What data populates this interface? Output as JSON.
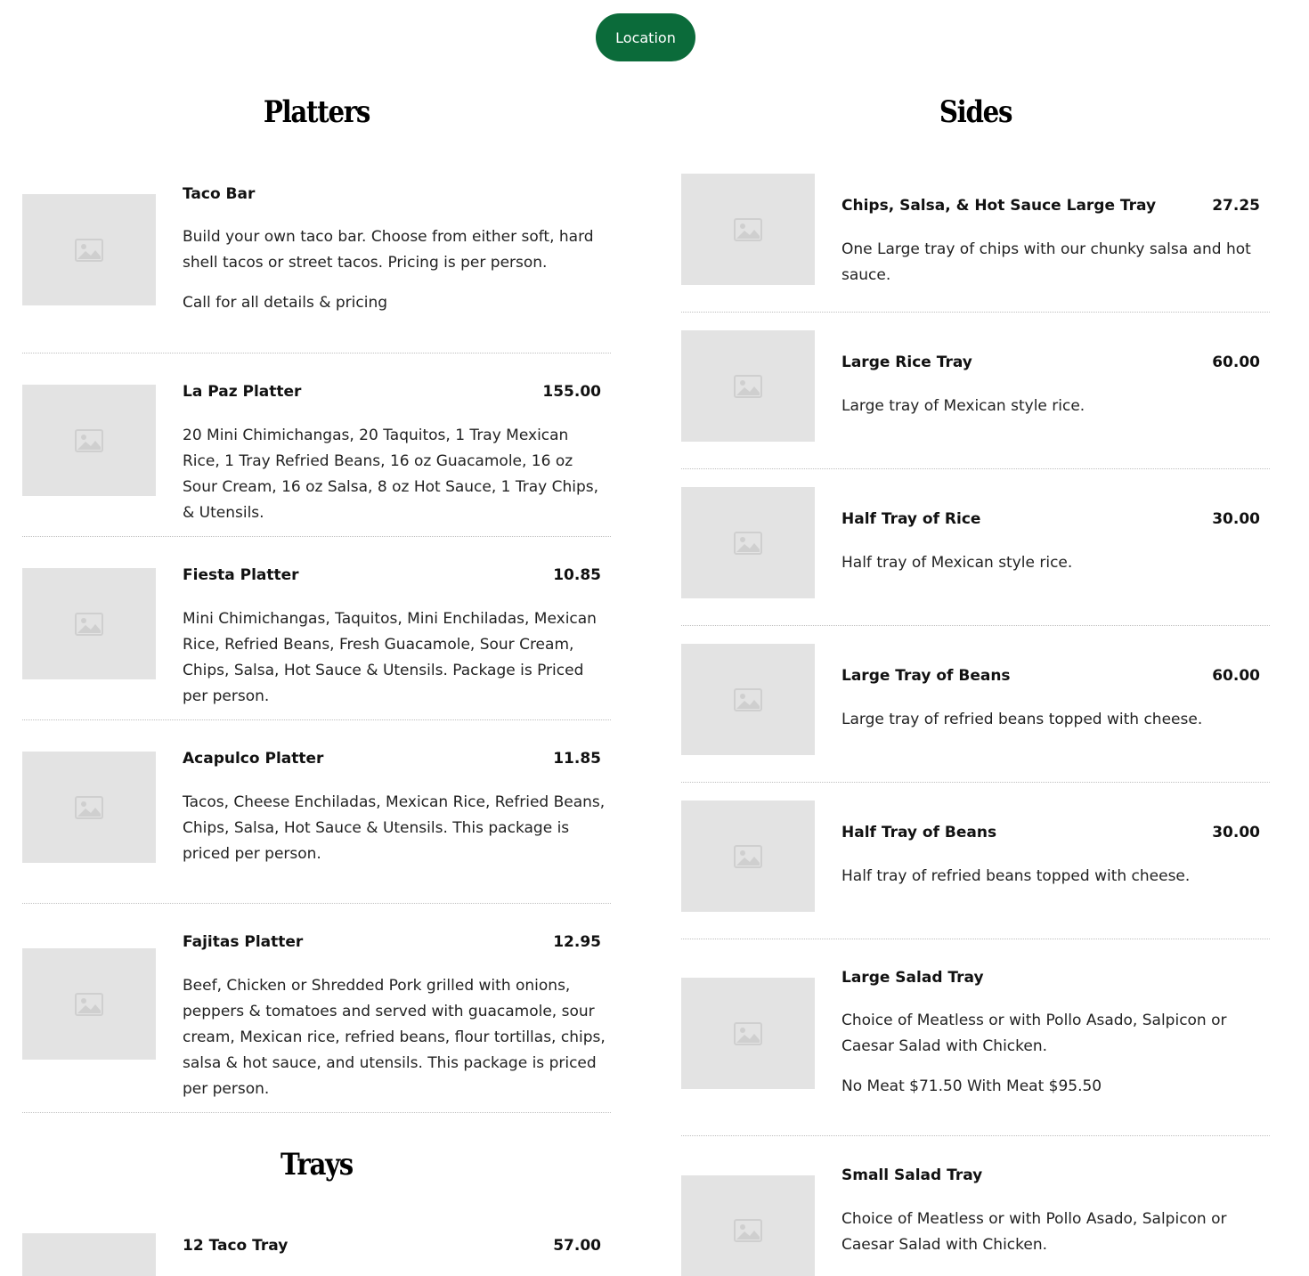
{
  "header": {
    "location_label": "Location"
  },
  "colors": {
    "accent": "#0b6b3a",
    "placeholder_bg": "#e3e3e3",
    "placeholder_icon": "#cfcfcf"
  },
  "platters": {
    "title": "Platters",
    "items": [
      {
        "name": "Taco Bar",
        "price": "",
        "description": "Build your own taco bar. Choose from either soft, hard shell tacos or street tacos. Pricing is per person.",
        "note": "Call for all details & pricing"
      },
      {
        "name": "La Paz Platter",
        "price": "155.00",
        "description": "20 Mini Chimichangas, 20 Taquitos, 1 Tray Mexican Rice, 1 Tray Refried Beans, 16 oz Guacamole, 16 oz Sour Cream, 16 oz Salsa, 8 oz Hot Sauce, 1 Tray Chips, & Utensils."
      },
      {
        "name": "Fiesta Platter",
        "price": "10.85",
        "description": "Mini Chimichangas, Taquitos, Mini Enchiladas, Mexican Rice, Refried Beans, Fresh Guacamole, Sour Cream, Chips, Salsa, Hot Sauce & Utensils. Package is Priced per person."
      },
      {
        "name": "Acapulco Platter",
        "price": "11.85",
        "description": "Tacos, Cheese Enchiladas, Mexican Rice, Refried Beans, Chips, Salsa, Hot Sauce & Utensils. This package is priced per person."
      },
      {
        "name": "Fajitas Platter",
        "price": "12.95",
        "description": "Beef, Chicken or  Shredded Pork grilled with onions, peppers & tomatoes and served with guacamole, sour cream, Mexican rice, refried beans, flour tortillas, chips, salsa & hot sauce, and utensils. This package is priced per person."
      }
    ]
  },
  "trays": {
    "title": "Trays",
    "items": [
      {
        "name": "12 Taco Tray",
        "price": "57.00"
      }
    ]
  },
  "sides": {
    "title": "Sides",
    "items": [
      {
        "name": "Chips, Salsa, & Hot Sauce Large Tray",
        "price": "27.25",
        "description": "One Large tray of chips with our chunky salsa and hot sauce."
      },
      {
        "name": "Large Rice Tray",
        "price": "60.00",
        "description": "Large tray of Mexican style rice."
      },
      {
        "name": "Half Tray of Rice",
        "price": "30.00",
        "description": "Half tray of Mexican style rice."
      },
      {
        "name": "Large Tray of Beans",
        "price": "60.00",
        "description": "Large tray of refried beans topped with cheese."
      },
      {
        "name": "Half Tray of Beans",
        "price": "30.00",
        "description": "Half tray of refried beans topped with cheese."
      },
      {
        "name": "Large Salad Tray",
        "price": "",
        "description": "Choice of Meatless or with Pollo Asado, Salpicon or Caesar Salad with Chicken.",
        "note": "No Meat $71.50 With Meat $95.50"
      },
      {
        "name": "Small Salad Tray",
        "price": "",
        "description": "Choice of Meatless or with Pollo Asado, Salpicon or Caesar Salad with Chicken."
      }
    ]
  }
}
